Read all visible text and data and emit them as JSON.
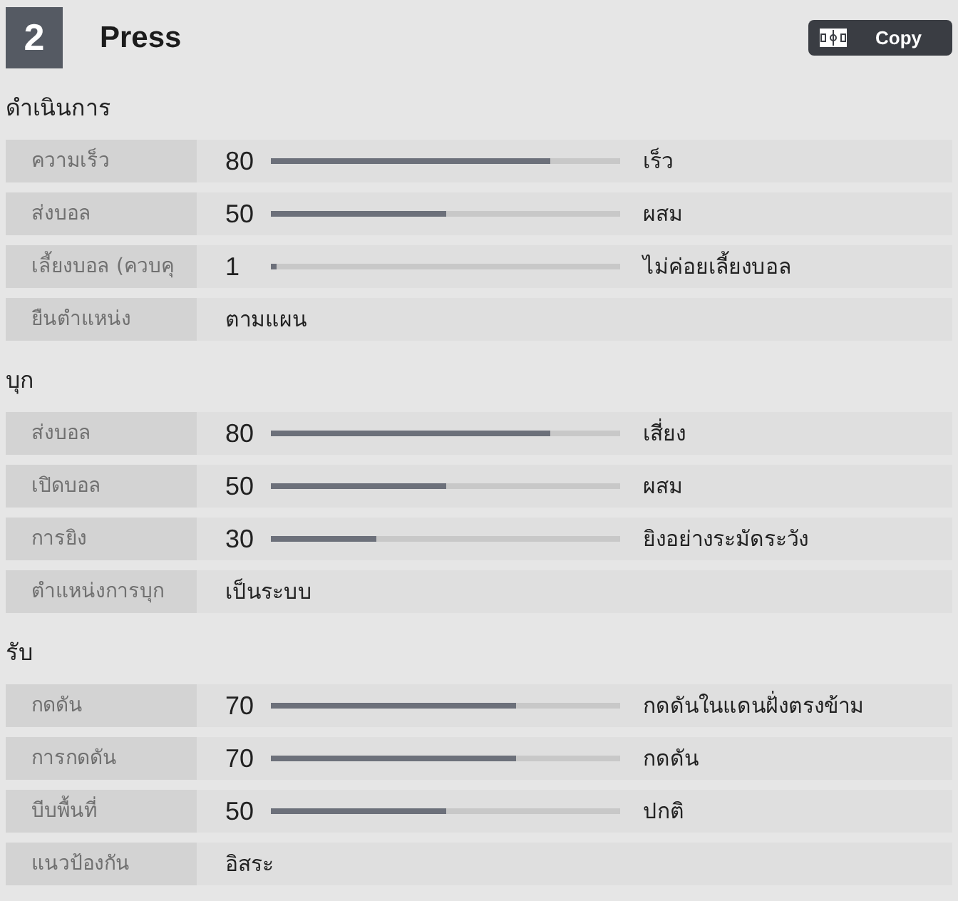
{
  "header": {
    "number": "2",
    "title": "Press",
    "copy_button": "Copy"
  },
  "sections": [
    {
      "title": "ดำเนินการ",
      "rows": [
        {
          "kind": "slider",
          "label": "ความเร็ว",
          "value": "80",
          "level": 0.8,
          "description": "เร็ว"
        },
        {
          "kind": "slider",
          "label": "ส่งบอล",
          "value": "50",
          "level": 0.5,
          "description": "ผสม"
        },
        {
          "kind": "slider",
          "label": "เลี้ยงบอล (ควบคุ",
          "value": "1",
          "level": 0.01,
          "description": "ไม่ค่อยเลี้ยงบอล"
        },
        {
          "kind": "text",
          "label": "ยืนตำแหน่ง",
          "value": "ตามแผน"
        }
      ]
    },
    {
      "title": "บุก",
      "rows": [
        {
          "kind": "slider",
          "label": "ส่งบอล",
          "value": "80",
          "level": 0.8,
          "description": "เสี่ยง"
        },
        {
          "kind": "slider",
          "label": "เปิดบอล",
          "value": "50",
          "level": 0.5,
          "description": "ผสม"
        },
        {
          "kind": "slider",
          "label": "การยิง",
          "value": "30",
          "level": 0.3,
          "description": "ยิงอย่างระมัดระวัง"
        },
        {
          "kind": "text",
          "label": "ตำแหน่งการบุก",
          "value": "เป็นระบบ"
        }
      ]
    },
    {
      "title": "รับ",
      "rows": [
        {
          "kind": "slider",
          "label": "กดดัน",
          "value": "70",
          "level": 0.7,
          "description": "กดดันในแดนฝั่งตรงข้าม"
        },
        {
          "kind": "slider",
          "label": "การกดดัน",
          "value": "70",
          "level": 0.7,
          "description": "กดดัน"
        },
        {
          "kind": "slider",
          "label": "บีบพื้นที่",
          "value": "50",
          "level": 0.5,
          "description": "ปกติ"
        },
        {
          "kind": "text",
          "label": "แนวป้องกัน",
          "value": "อิสระ"
        }
      ]
    }
  ]
}
